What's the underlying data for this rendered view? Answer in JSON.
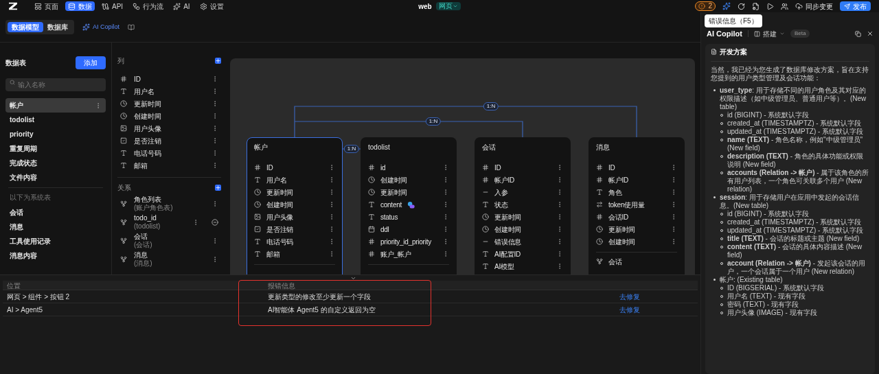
{
  "topbar": {
    "nav": [
      {
        "label": "页面",
        "selected": false
      },
      {
        "label": "数据",
        "selected": true
      },
      {
        "label": "API",
        "selected": false
      },
      {
        "label": "行为流",
        "selected": false
      },
      {
        "label": "AI",
        "selected": false
      },
      {
        "label": "设置",
        "selected": false
      }
    ],
    "project": "web",
    "env": "网页",
    "error_count": "2",
    "sync": "同步变更",
    "publish": "发布"
  },
  "tooltip": "错误信息（F5）",
  "subnav": {
    "tabs": [
      {
        "label": "数据模型",
        "selected": true
      },
      {
        "label": "数据库",
        "selected": false
      }
    ],
    "copilot": "AI Copilot"
  },
  "tables_panel": {
    "title": "数据表",
    "add": "添加",
    "search_placeholder": "输入名称",
    "items": [
      {
        "label": "帐户",
        "selected": true
      },
      {
        "label": "todolist",
        "selected": false
      },
      {
        "label": "priority",
        "selected": false
      },
      {
        "label": "重复周期",
        "selected": false
      },
      {
        "label": "完成状态",
        "selected": false
      },
      {
        "label": "文件内容",
        "selected": false
      }
    ],
    "system_heading": "以下为系统表",
    "system_items": [
      {
        "label": "会话",
        "selected": false
      },
      {
        "label": "消息",
        "selected": false
      },
      {
        "label": "工具使用记录",
        "selected": false
      },
      {
        "label": "消息内容",
        "selected": false
      }
    ]
  },
  "columns_panel": {
    "columns_heading": "列",
    "columns": [
      {
        "name": "ID",
        "kind": "id"
      },
      {
        "name": "用户名",
        "kind": "text"
      },
      {
        "name": "更新时间",
        "kind": "time"
      },
      {
        "name": "创建时间",
        "kind": "time"
      },
      {
        "name": "用户头像",
        "kind": "image"
      },
      {
        "name": "是否注销",
        "kind": "bool"
      },
      {
        "name": "电话号码",
        "kind": "text"
      },
      {
        "name": "邮箱",
        "kind": "text"
      }
    ],
    "relations_heading": "关系",
    "relations": [
      {
        "name": "角色列表",
        "target": "(账户角色表)",
        "removable": false
      },
      {
        "name": "todo_id",
        "target": "(todolist)",
        "removable": true
      },
      {
        "name": "会话",
        "target": "(会话)",
        "removable": false
      },
      {
        "name": "消息",
        "target": "(消息)",
        "removable": false
      }
    ]
  },
  "canvas": {
    "cards": [
      {
        "title": "帐户",
        "selected": true,
        "divider": true,
        "fields": [
          {
            "name": "ID",
            "kind": "id"
          },
          {
            "name": "用户名",
            "kind": "text"
          },
          {
            "name": "更新时间",
            "kind": "time"
          },
          {
            "name": "创建时间",
            "kind": "time"
          },
          {
            "name": "用户头像",
            "kind": "image"
          },
          {
            "name": "是否注销",
            "kind": "bool"
          },
          {
            "name": "电话号码",
            "kind": "text"
          },
          {
            "name": "邮箱",
            "kind": "text"
          }
        ]
      },
      {
        "title": "todolist",
        "selected": false,
        "divider": true,
        "fields": [
          {
            "name": "id",
            "kind": "id"
          },
          {
            "name": "创建时间",
            "kind": "time"
          },
          {
            "name": "更新时间",
            "kind": "time"
          },
          {
            "name": "content",
            "kind": "text",
            "ai": true
          },
          {
            "name": "status",
            "kind": "text"
          },
          {
            "name": "ddl",
            "kind": "date"
          },
          {
            "name": "priority_id_priority",
            "kind": "id"
          },
          {
            "name": "账户_帐户",
            "kind": "id"
          }
        ]
      },
      {
        "title": "会话",
        "selected": false,
        "fields": [
          {
            "name": "ID",
            "kind": "id"
          },
          {
            "name": "帐户ID",
            "kind": "id"
          },
          {
            "name": "入参",
            "kind": "param"
          },
          {
            "name": "状态",
            "kind": "text"
          },
          {
            "name": "更新时间",
            "kind": "time"
          },
          {
            "name": "创建时间",
            "kind": "time"
          },
          {
            "name": "错误信息",
            "kind": "param"
          },
          {
            "name": "AI配置ID",
            "kind": "text"
          },
          {
            "name": "AI模型",
            "kind": "text"
          }
        ]
      },
      {
        "title": "消息",
        "selected": false,
        "divider": true,
        "fields": [
          {
            "name": "ID",
            "kind": "id"
          },
          {
            "name": "帐户ID",
            "kind": "id"
          },
          {
            "name": "角色",
            "kind": "text"
          },
          {
            "name": "token使用量",
            "kind": "number"
          },
          {
            "name": "会话ID",
            "kind": "id"
          },
          {
            "name": "更新时间",
            "kind": "time"
          },
          {
            "name": "创建时间",
            "kind": "time"
          }
        ],
        "relations": [
          {
            "name": "会话"
          }
        ]
      }
    ],
    "links": [
      {
        "label": "1:N"
      },
      {
        "label": "1:N"
      },
      {
        "label": "1:N"
      }
    ]
  },
  "copilot": {
    "title": "AI Copilot",
    "mode": "搭建",
    "badge": "Beta",
    "plan_title": "开发方案",
    "intro": "当然，我已经为您生成了数据库修改方案，旨在支持您提到的用户类型管理及会话功能：",
    "items": [
      {
        "text": "**user_type**: 用于存储不同的用户角色及其对应的权限描述（如中级管理员、普通用户等）。(New table)",
        "children": [
          {
            "text": "id (BIGINT) - 系统默认字段"
          },
          {
            "text": "created_at (TIMESTAMPTZ) - 系统默认字段"
          },
          {
            "text": "updated_at (TIMESTAMPTZ) - 系统默认字段"
          },
          {
            "text": "**name (TEXT)** - 角色名称，例如\"中级管理员\" (New field)"
          },
          {
            "text": "**description (TEXT)** - 角色的具体功能或权限说明 (New field)"
          },
          {
            "text": "**accounts (Relation -> 帐户)** - 属于该角色的所有用户列表，一个角色可关联多个用户 (New relation)"
          }
        ]
      },
      {
        "text": "**session**: 用于存储用户在应用中发起的会话信息。(New table)",
        "children": [
          {
            "text": "id (BIGINT) - 系统默认字段"
          },
          {
            "text": "created_at (TIMESTAMPTZ) - 系统默认字段"
          },
          {
            "text": "updated_at (TIMESTAMPTZ) - 系统默认字段"
          },
          {
            "text": "**title (TEXT)** - 会话的标题或主题 (New field)"
          },
          {
            "text": "**content (TEXT)** - 会话的具体内容描述 (New field)"
          },
          {
            "text": "**account (Relation -> 帐户)** - 发起该会话的用户，一个会话属于一个用户 (New relation)"
          }
        ]
      },
      {
        "text": "帐户: (Existing table)",
        "children": [
          {
            "text": "ID (BIGSERIAL) - 系统默认字段"
          },
          {
            "text": "用户名 (TEXT) - 现有字段"
          },
          {
            "text": "密码 (TEXT) - 现有字段"
          },
          {
            "text": "用户头像 (IMAGE) - 现有字段"
          }
        ]
      }
    ]
  },
  "errors": {
    "columns": [
      "位置",
      "报错信息"
    ],
    "rows": [
      {
        "location": "网页 > 组件 > 按钮 2",
        "message": "更新类型的修改至少更新一个字段",
        "action": "去修复"
      },
      {
        "location": "AI > Agent5",
        "message": "AI智能体 Agent5 的自定义返回为空",
        "action": "去修复"
      }
    ]
  }
}
